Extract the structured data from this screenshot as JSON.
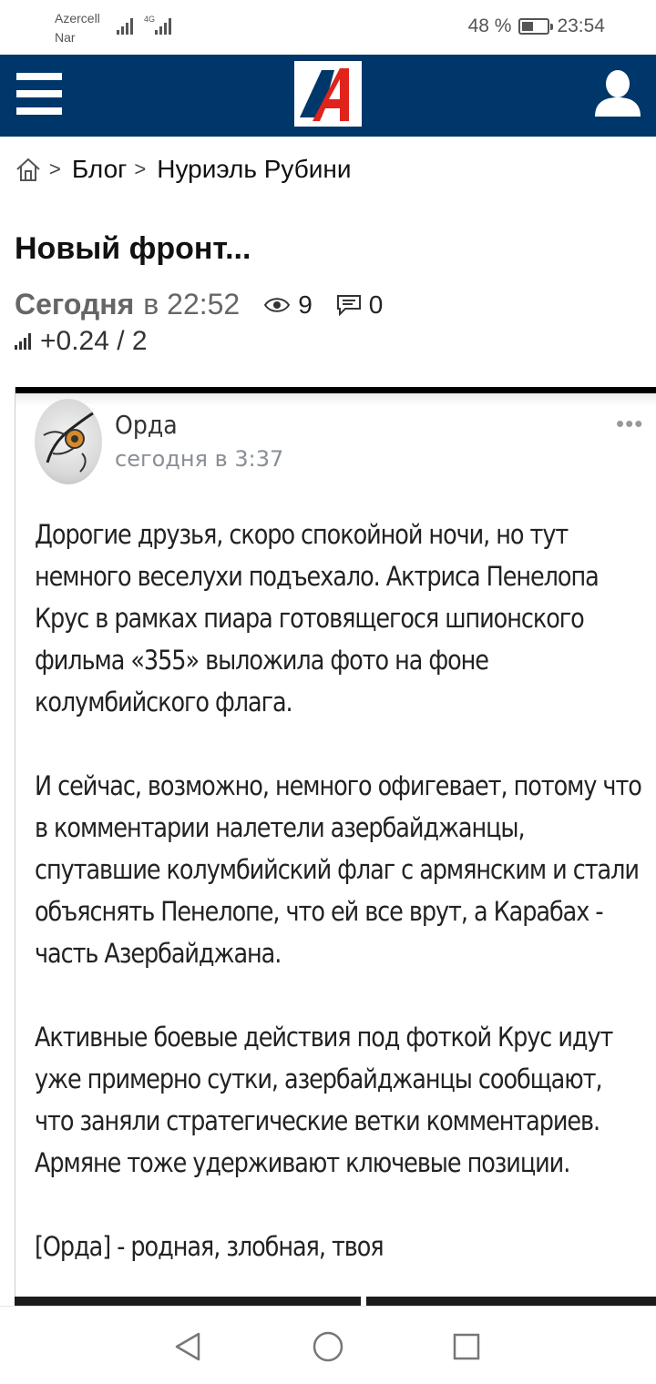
{
  "status_bar": {
    "carrier1": "Azercell",
    "carrier2": "Nar",
    "network_type": "4G",
    "battery_percent": "48 %",
    "battery_level": 0.48,
    "time": "23:54"
  },
  "header": {
    "menu_icon": "hamburger-menu-icon",
    "logo_icon": "site-logo-icon",
    "user_icon": "user-profile-icon",
    "background_color": "#00376b"
  },
  "breadcrumb": {
    "home_icon": "home-icon",
    "separator": ">",
    "items": [
      "Блог",
      "Нуриэль Рубини"
    ]
  },
  "post": {
    "title": "Новый фронт...",
    "date_bold": "Сегодня",
    "time": "в 22:52",
    "views": "9",
    "comments": "0",
    "rating": "+0.24 / 2"
  },
  "embed": {
    "author": "Орда",
    "time": "сегодня в 3:37",
    "more": "•••",
    "paragraphs": [
      "Дорогие друзья, скоро спокойной ночи, но тут немного веселухи подъехало. Актриса Пенелопа Крус в рамках пиара готовящегося шпионского фильма «355» выложила фото на фоне колумбийского флага.",
      "И сейчас, возможно, немного офигевает, потому что в комментарии налетели азербайджанцы, спутавшие колумбийский флаг с армянским и стали объяснять Пенелопе, что ей все врут, а Карабах - часть Азербайджана.",
      "Активные боевые действия под фоткой Крус идут уже примерно сутки, азербайджанцы сообщают, что заняли стратегические ветки комментариев. Армяне тоже удерживают ключевые позиции.",
      "[Орда] - родная, злобная, твоя"
    ]
  },
  "nav": {
    "back_icon": "back-triangle-icon",
    "home_icon": "home-circle-icon",
    "recents_icon": "recents-square-icon"
  }
}
